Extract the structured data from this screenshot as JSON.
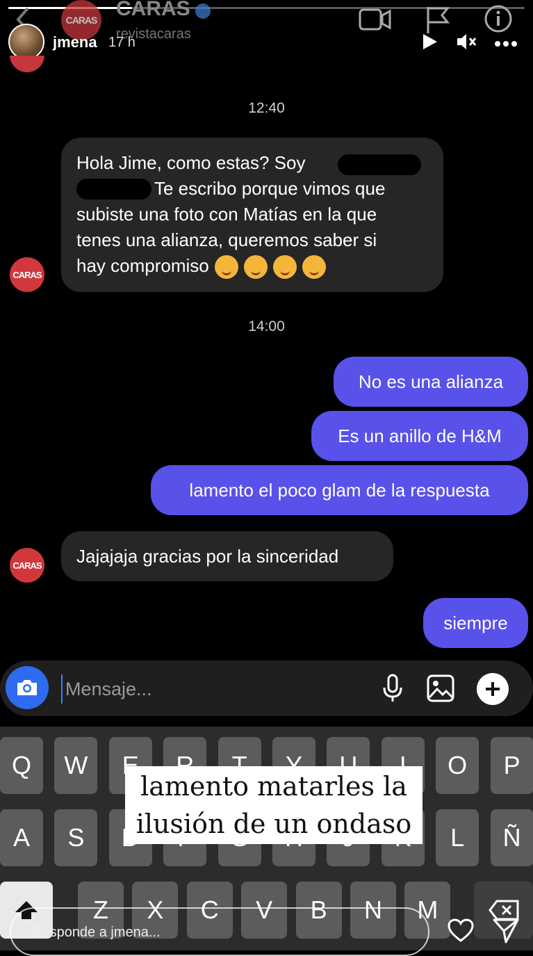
{
  "story": {
    "username": "jmena",
    "time": "17 h",
    "progress": 0.24
  },
  "dm_header": {
    "title": "CARAS",
    "subtitle": "revistacaras",
    "avatar_text": "CARAS"
  },
  "chat": {
    "time1": "12:40",
    "msg1_part1": "Hola Jime, como estas? Soy",
    "msg1_part2": "Te escribo porque vimos que",
    "msg1_part3": "subiste una foto con Matías en la que",
    "msg1_part4": "tenes una alianza, queremos saber si",
    "msg1_part5": "hay compromiso",
    "avatar_text": "CARAS",
    "time2": "14:00",
    "out1": "No es una alianza",
    "out2": "Es un anillo de H&M",
    "out3": "lamento el poco glam de la respuesta",
    "in2": "Jajajaja gracias por la sinceridad",
    "out4": "siempre"
  },
  "composer": {
    "placeholder": "Mensaje..."
  },
  "keyboard": {
    "row1": [
      "Q",
      "W",
      "E",
      "R",
      "T",
      "Y",
      "U",
      "I",
      "O",
      "P"
    ],
    "row2": [
      "A",
      "S",
      "D",
      "F",
      "G",
      "H",
      "J",
      "K",
      "L",
      "Ñ"
    ],
    "row3": [
      "Z",
      "X",
      "C",
      "V",
      "B",
      "N",
      "M"
    ]
  },
  "overlay": {
    "line1": "lamento matarles la",
    "line2": "ilusión de un ondaso"
  },
  "reply": {
    "placeholder": "Responde a jmena..."
  },
  "colors": {
    "outgoing_bubble": "#5851ea",
    "incoming_bubble": "#262626",
    "caras_red": "#d0383c",
    "camera_blue": "#2f6bf0"
  }
}
